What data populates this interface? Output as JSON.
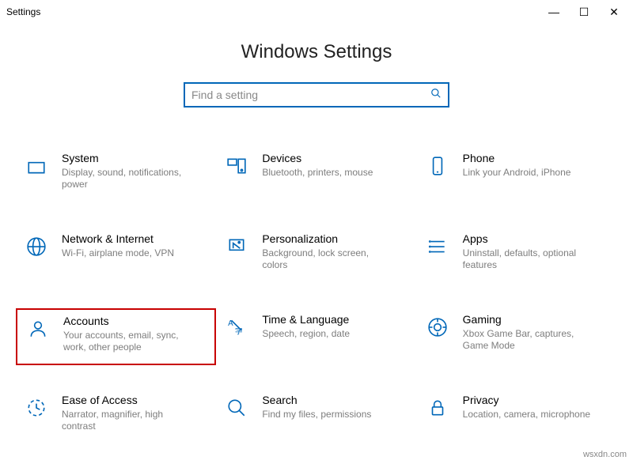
{
  "window": {
    "title": "Settings",
    "min": "—",
    "max": "☐",
    "close": "✕"
  },
  "header": {
    "page_title": "Windows Settings"
  },
  "search": {
    "placeholder": "Find a setting",
    "value": ""
  },
  "tiles": [
    {
      "key": "system",
      "title": "System",
      "desc": "Display, sound, notifications, power"
    },
    {
      "key": "devices",
      "title": "Devices",
      "desc": "Bluetooth, printers, mouse"
    },
    {
      "key": "phone",
      "title": "Phone",
      "desc": "Link your Android, iPhone"
    },
    {
      "key": "network",
      "title": "Network & Internet",
      "desc": "Wi-Fi, airplane mode, VPN"
    },
    {
      "key": "personalization",
      "title": "Personalization",
      "desc": "Background, lock screen, colors"
    },
    {
      "key": "apps",
      "title": "Apps",
      "desc": "Uninstall, defaults, optional features"
    },
    {
      "key": "accounts",
      "title": "Accounts",
      "desc": "Your accounts, email, sync, work, other people",
      "highlighted": true
    },
    {
      "key": "time",
      "title": "Time & Language",
      "desc": "Speech, region, date"
    },
    {
      "key": "gaming",
      "title": "Gaming",
      "desc": "Xbox Game Bar, captures, Game Mode"
    },
    {
      "key": "ease",
      "title": "Ease of Access",
      "desc": "Narrator, magnifier, high contrast"
    },
    {
      "key": "search",
      "title": "Search",
      "desc": "Find my files, permissions"
    },
    {
      "key": "privacy",
      "title": "Privacy",
      "desc": "Location, camera, microphone"
    }
  ],
  "watermark": "wsxdn.com"
}
